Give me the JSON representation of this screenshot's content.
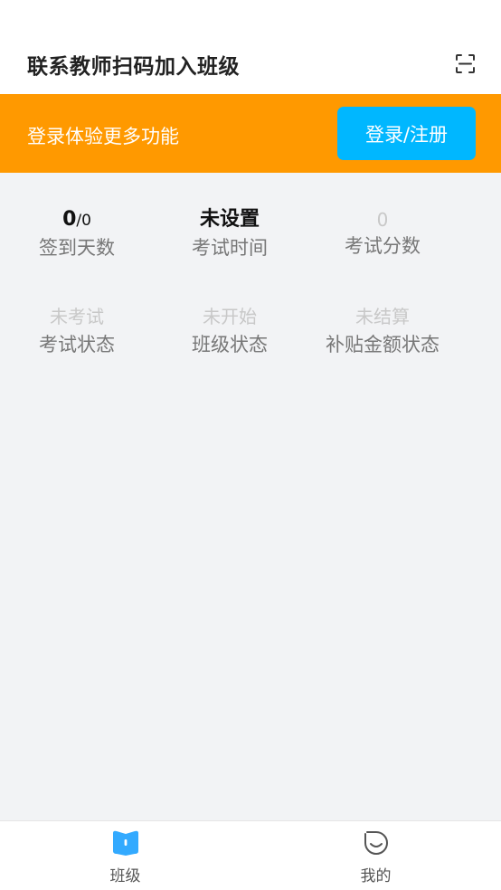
{
  "header": {
    "title": "联系教师扫码加入班级",
    "scan_icon": "scan-icon"
  },
  "login_banner": {
    "text": "登录体验更多功能",
    "button_label": "登录/注册",
    "background_color": "#ff9900",
    "button_color": "#00b7ff"
  },
  "stats": {
    "signin": {
      "value_main": "0",
      "value_sep": "/",
      "value_total": "0",
      "label": "签到天数"
    },
    "exam_time": {
      "value": "未设置",
      "label": "考试时间"
    },
    "exam_score": {
      "value": "0",
      "label": "考试分数"
    },
    "exam_status": {
      "value": "未考试",
      "label": "考试状态"
    },
    "class_status": {
      "value": "未开始",
      "label": "班级状态"
    },
    "subsidy_status": {
      "value": "未结算",
      "label": "补贴金额状态"
    }
  },
  "bottom_nav": {
    "items": [
      {
        "label": "班级",
        "icon": "book-icon",
        "active": true,
        "color": "#33aaff"
      },
      {
        "label": "我的",
        "icon": "smile-face-icon",
        "active": false,
        "color": "#555555"
      }
    ]
  }
}
